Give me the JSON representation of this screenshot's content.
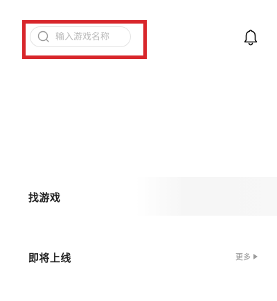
{
  "search": {
    "placeholder": "输入游戏名称",
    "value": ""
  },
  "header": {
    "notification_icon": "bell-icon"
  },
  "sections": {
    "find_games": "找游戏",
    "upcoming": "即将上线",
    "more_label": "更多"
  },
  "colors": {
    "highlight": "#d8262b",
    "text_primary": "#222222",
    "text_secondary": "#8f8f8f",
    "placeholder": "#b8b8b8"
  }
}
